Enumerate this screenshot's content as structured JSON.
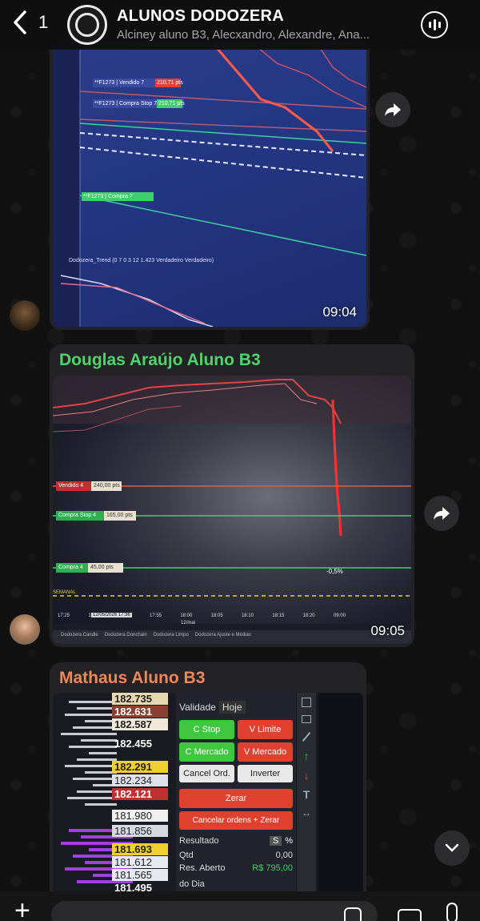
{
  "header": {
    "back_count": "1",
    "title": "ALUNOS DODOZERA",
    "subtitle": "Alciney aluno B3, Alecxandro, Alexandre, Ana..."
  },
  "messages": [
    {
      "sender": "",
      "time": "09:04",
      "chart_labels": [
        "**F1273 | Vendido 7",
        "210,71 pts",
        "**F1273 | Compra Stop 7",
        "210,71 pts",
        "**F1273 | Compra 7",
        "Dodozera_Trend (0 7 0 3 12 1.423 Verdadeiro Verdadeiro)"
      ]
    },
    {
      "sender": "Douglas Araújo Aluno B3",
      "sender_color": "#4fd46b",
      "time": "09:05",
      "chart_labels": [
        "Vendido 4",
        "240,00 pts",
        "Compra Stop 4",
        "165,00 pts",
        "Compra 4",
        "45,00 pts",
        "-0,5%",
        "SEMANAL",
        "12/mai",
        "12/05/2026 17:36"
      ],
      "x_ticks": [
        "17:25",
        "17:45",
        "17:50",
        "17:55",
        "18:00",
        "18:05",
        "18:10",
        "18:15",
        "18:20",
        "09:00"
      ],
      "tabs": [
        "Dodozera Candle",
        "Dodozera Donchain",
        "Dodozera Limpo",
        "Dodozera Ajuste e Médias"
      ]
    },
    {
      "sender": "Mathaus Aluno B3",
      "sender_color": "#f0875a",
      "dom_prices": [
        "182.735",
        "182.631",
        "182.587",
        "182.455",
        "182.291",
        "182.234",
        "182.121",
        "181.980",
        "181.856",
        "181.693",
        "181.612",
        "181.565",
        "181.495"
      ],
      "validade_label": "Validade",
      "validade_value": "Hoje",
      "buttons": [
        "C Stop",
        "V Limite",
        "C Mercado",
        "V Mercado",
        "Cancel Ord.",
        "Inverter",
        "Zerar",
        "Cancelar ordens + Zerar"
      ],
      "resultado_label": "Resultado",
      "toggle_s": "S",
      "toggle_pct": "%",
      "qtd_label": "Qtd",
      "qtd_value": "0,00",
      "res_aberto_label": "Res. Aberto",
      "res_aberto_value": "R$ 795,00",
      "res_dia_label": "do Dia"
    }
  ],
  "colors": {
    "accent_green": "#4fd46b",
    "accent_orange": "#f0875a",
    "bubble": "#232325"
  }
}
